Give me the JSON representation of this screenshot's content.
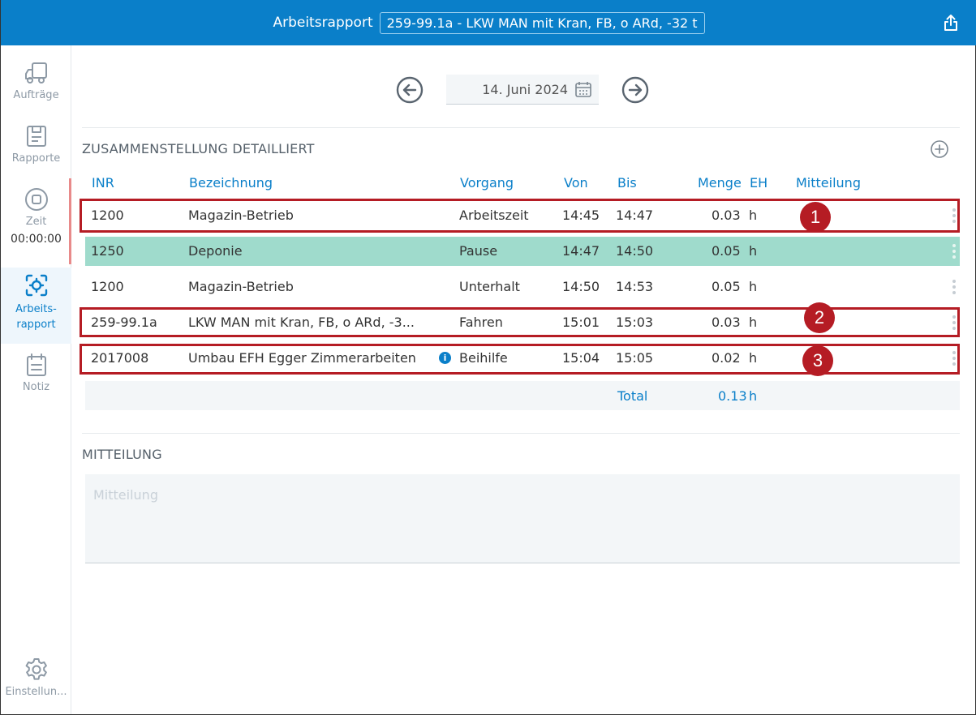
{
  "header": {
    "title": "Arbeitsrapport",
    "selector_value": "259-99.1a - LKW MAN mit Kran, FB, o ARd, -32 t"
  },
  "sidebar": {
    "items": [
      {
        "label": "Aufträge",
        "icon": "truck-icon"
      },
      {
        "label": "Rapporte",
        "icon": "clipboard-icon"
      },
      {
        "label": "Zeit",
        "icon": "stop-circle-icon",
        "time": "00:00:00"
      },
      {
        "label": "Arbeits-\nrapport",
        "icon": "target-icon"
      },
      {
        "label": "Notiz",
        "icon": "calendar-note-icon"
      },
      {
        "label": "Einstellun...",
        "icon": "gear-icon"
      }
    ]
  },
  "date_nav": {
    "date": "14. Juni 2024"
  },
  "summary": {
    "title": "ZUSAMMENSTELLUNG DETAILLIERT",
    "columns": {
      "inr": "INR",
      "bezeichnung": "Bezeichnung",
      "vorgang": "Vorgang",
      "von": "Von",
      "bis": "Bis",
      "menge": "Menge",
      "eh": "EH",
      "mitteilung": "Mitteilung"
    },
    "rows": [
      {
        "inr": "1200",
        "bezeichnung": "Magazin-Betrieb",
        "vorgang": "Arbeitszeit",
        "von": "14:45",
        "bis": "14:47",
        "menge": "0.03",
        "eh": "h"
      },
      {
        "inr": "1250",
        "bezeichnung": "Deponie",
        "vorgang": "Pause",
        "von": "14:47",
        "bis": "14:50",
        "menge": "0.05",
        "eh": "h"
      },
      {
        "inr": "1200",
        "bezeichnung": "Magazin-Betrieb",
        "vorgang": "Unterhalt",
        "von": "14:50",
        "bis": "14:53",
        "menge": "0.05",
        "eh": "h"
      },
      {
        "inr": "259-99.1a",
        "bezeichnung": "LKW MAN mit Kran, FB, o ARd, -3...",
        "vorgang": "Fahren",
        "von": "15:01",
        "bis": "15:03",
        "menge": "0.03",
        "eh": "h"
      },
      {
        "inr": "2017008",
        "bezeichnung": "Umbau EFH Egger Zimmerarbeiten",
        "vorgang": "Beihilfe",
        "von": "15:04",
        "bis": "15:05",
        "menge": "0.02",
        "eh": "h",
        "info_icon": "i"
      }
    ],
    "total": {
      "label": "Total",
      "value": "0.13",
      "eh": "h"
    }
  },
  "callouts": [
    "1",
    "2",
    "3"
  ],
  "mitteilung": {
    "title": "MITTEILUNG",
    "placeholder": "Mitteilung"
  },
  "colors": {
    "header_bg": "#0a7fc9",
    "accent": "#0a7fc9",
    "row_highlight": "#9fdbcc",
    "callout": "#b51c24"
  }
}
